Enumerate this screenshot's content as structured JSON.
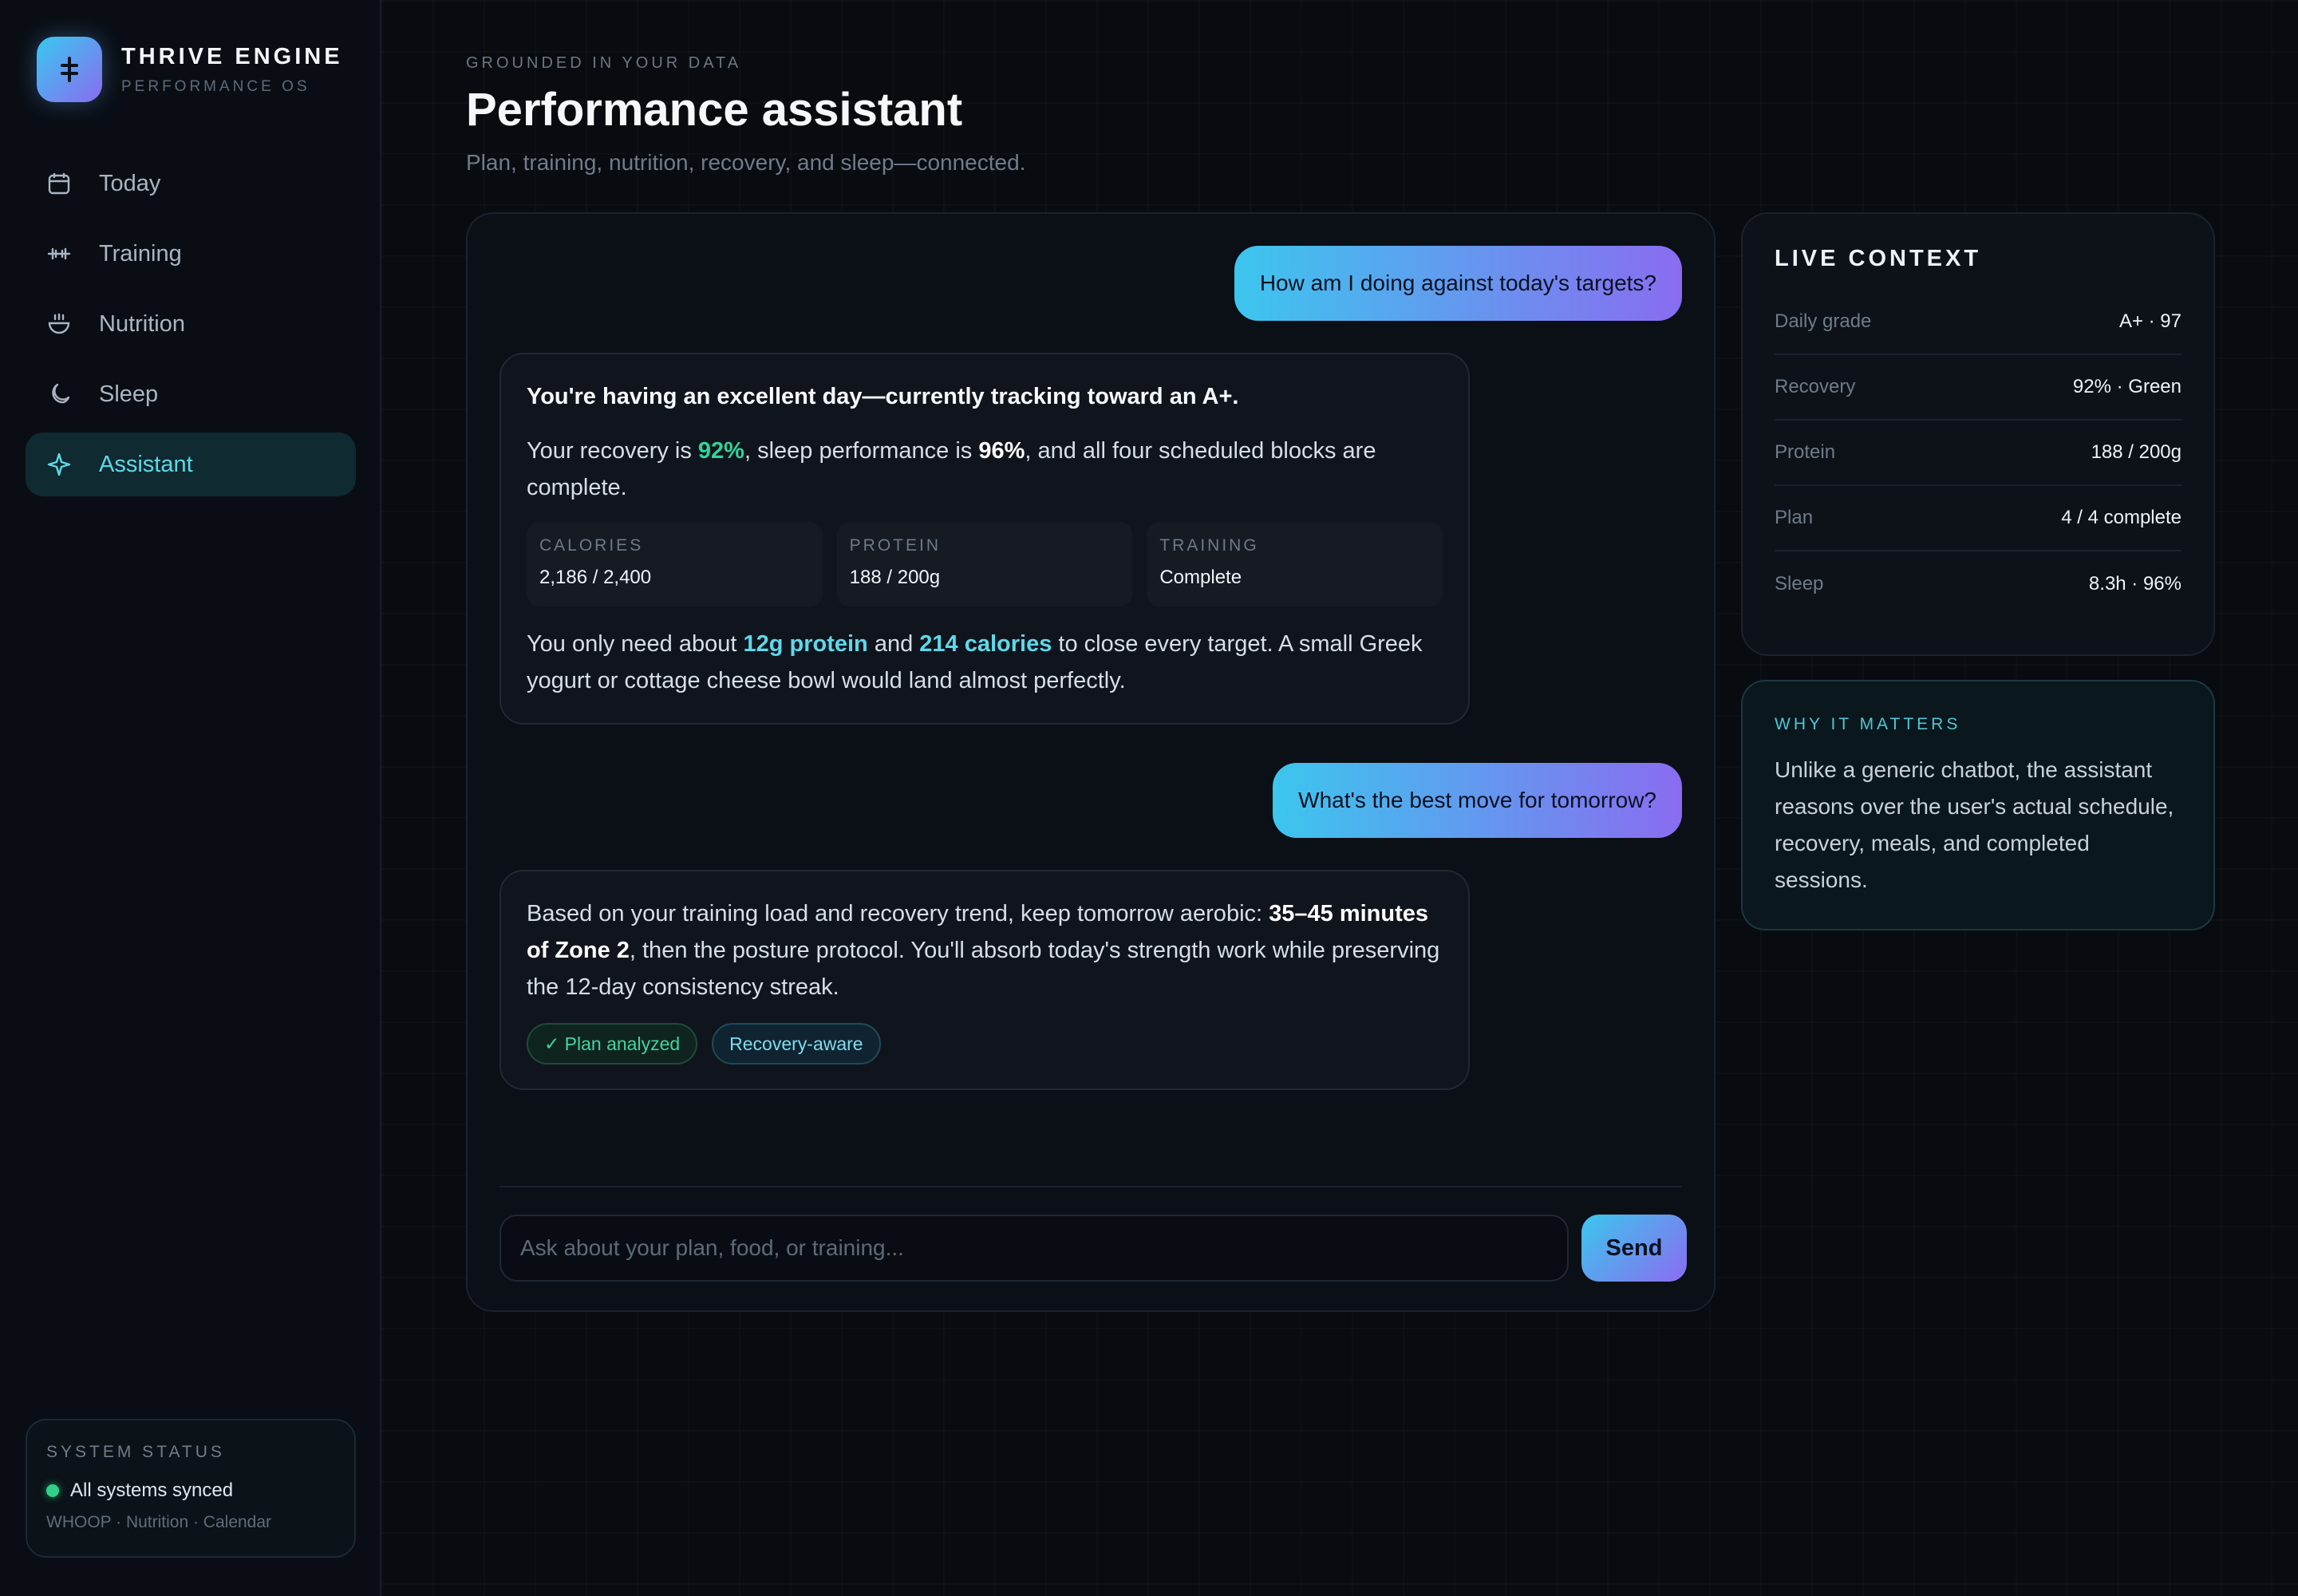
{
  "brand": {
    "name": "THRIVE ENGINE",
    "subtitle": "PERFORMANCE OS",
    "logo_icon": "cross-bar-icon"
  },
  "nav": [
    {
      "label": "Today",
      "icon": "calendar-icon",
      "active": false
    },
    {
      "label": "Training",
      "icon": "dumbbell-icon",
      "active": false
    },
    {
      "label": "Nutrition",
      "icon": "bowl-icon",
      "active": false
    },
    {
      "label": "Sleep",
      "icon": "moon-icon",
      "active": false
    },
    {
      "label": "Assistant",
      "icon": "sparkle-icon",
      "active": true
    }
  ],
  "system_status": {
    "title": "SYSTEM STATUS",
    "state": "All systems synced",
    "sources": "WHOOP · Nutrition · Calendar"
  },
  "header": {
    "eyebrow": "GROUNDED IN YOUR DATA",
    "title": "Performance assistant",
    "subtitle": "Plan, training, nutrition, recovery, and sleep—connected."
  },
  "chat": {
    "user_message_1": "How am I doing against today's targets?",
    "reply_1": {
      "headline": "You're having an excellent day—currently tracking toward an A+.",
      "p1_a": "Your recovery is ",
      "p1_recovery": "92%",
      "p1_b": ", sleep performance is ",
      "p1_sleep": "96%",
      "p1_c": ", and all four scheduled blocks are complete.",
      "metrics": [
        {
          "label": "CALORIES",
          "value": "2,186 / 2,400"
        },
        {
          "label": "PROTEIN",
          "value": "188 / 200g"
        },
        {
          "label": "TRAINING",
          "value": "Complete"
        }
      ],
      "p2_a": "You only need about ",
      "p2_protein": "12g protein",
      "p2_b": " and ",
      "p2_calories": "214 calories",
      "p2_c": " to close every target. A small Greek yogurt or cottage cheese bowl would land almost perfectly."
    },
    "user_message_2": "What's the best move for tomorrow?",
    "reply_2": {
      "a": "Based on your training load and recovery trend, keep tomorrow aerobic: ",
      "strong": "35–45 minutes of Zone 2",
      "b": ", then the posture protocol. You'll absorb today's strength work while preserving the 12-day consistency streak.",
      "tags": [
        "✓ Plan analyzed",
        "Recovery-aware"
      ]
    },
    "input_placeholder": "Ask about your plan, food, or training...",
    "send_label": "Send"
  },
  "live_context": {
    "title": "LIVE CONTEXT",
    "rows": [
      {
        "label": "Daily grade",
        "value": "A+ · 97"
      },
      {
        "label": "Recovery",
        "value": "92% · Green"
      },
      {
        "label": "Protein",
        "value": "188 / 200g"
      },
      {
        "label": "Plan",
        "value": "4 / 4 complete"
      },
      {
        "label": "Sleep",
        "value": "8.3h · 96%"
      }
    ]
  },
  "why_it_matters": {
    "title": "WHY IT MATTERS",
    "body": "Unlike a generic chatbot, the assistant reasons over the user's actual schedule, recovery, meals, and completed sessions."
  },
  "colors": {
    "accent_cyan": "#3cc6ee",
    "accent_violet": "#8a6cf0",
    "success_green": "#33d39a",
    "background": "#080b10"
  }
}
